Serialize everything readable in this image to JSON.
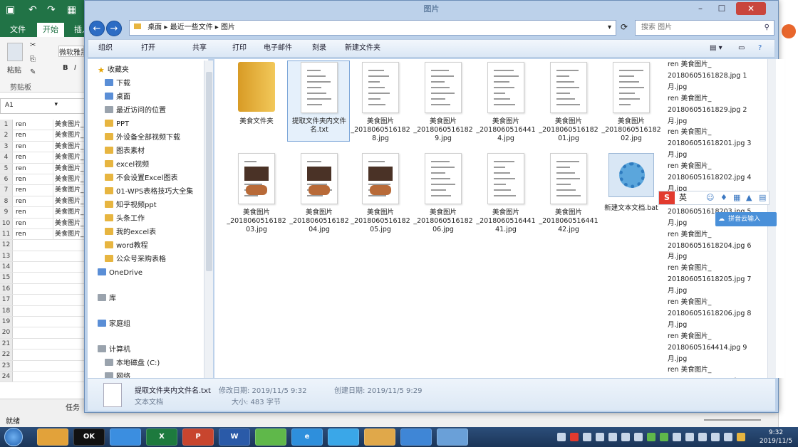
{
  "excel": {
    "tabs": [
      "文件",
      "开始",
      "插入"
    ],
    "font_box": "微软雅黑",
    "paste_label": "粘贴",
    "clipboard_label": "剪贴板",
    "name_box": "A1",
    "rows": [
      {
        "n": "1",
        "a": "ren",
        "b": "美食图片_"
      },
      {
        "n": "2",
        "a": "ren",
        "b": "美食图片_"
      },
      {
        "n": "3",
        "a": "ren",
        "b": "美食图片_"
      },
      {
        "n": "4",
        "a": "ren",
        "b": "美食图片_"
      },
      {
        "n": "5",
        "a": "ren",
        "b": "美食图片_"
      },
      {
        "n": "6",
        "a": "ren",
        "b": "美食图片_"
      },
      {
        "n": "7",
        "a": "ren",
        "b": "美食图片_"
      },
      {
        "n": "8",
        "a": "ren",
        "b": "美食图片_"
      },
      {
        "n": "9",
        "a": "ren",
        "b": "美食图片_"
      },
      {
        "n": "10",
        "a": "ren",
        "b": "美食图片_"
      },
      {
        "n": "11",
        "a": "ren",
        "b": "美食图片_"
      },
      {
        "n": "12",
        "a": "",
        "b": ""
      },
      {
        "n": "13",
        "a": "",
        "b": ""
      },
      {
        "n": "14",
        "a": "",
        "b": ""
      },
      {
        "n": "15",
        "a": "",
        "b": ""
      },
      {
        "n": "16",
        "a": "",
        "b": ""
      },
      {
        "n": "17",
        "a": "",
        "b": ""
      },
      {
        "n": "18",
        "a": "",
        "b": ""
      },
      {
        "n": "19",
        "a": "",
        "b": ""
      },
      {
        "n": "20",
        "a": "",
        "b": ""
      },
      {
        "n": "21",
        "a": "",
        "b": ""
      },
      {
        "n": "22",
        "a": "",
        "b": ""
      },
      {
        "n": "23",
        "a": "",
        "b": ""
      },
      {
        "n": "24",
        "a": "",
        "b": ""
      }
    ],
    "status": "就绪",
    "sheet_tab": "任务"
  },
  "explorer": {
    "title": "图片",
    "address": [
      "桌面",
      "最近一些文件",
      "图片"
    ],
    "search_placeholder": "搜索 图片",
    "toolbar": [
      "组织",
      "打开",
      "共享",
      "打印",
      "电子邮件",
      "刻录",
      "新建文件夹"
    ],
    "nav": [
      {
        "label": "收藏夹",
        "icon": "star"
      },
      {
        "label": "下载",
        "icon": "blue"
      },
      {
        "label": "桌面",
        "icon": "blue"
      },
      {
        "label": "最近访问的位置",
        "icon": "gray"
      },
      {
        "label": "PPT",
        "icon": "folder"
      },
      {
        "label": "外设备全部视频下载",
        "icon": "folder"
      },
      {
        "label": "图表素材",
        "icon": "folder"
      },
      {
        "label": "excel视频",
        "icon": "folder"
      },
      {
        "label": "不会设置Excel图表",
        "icon": "folder"
      },
      {
        "label": "01-WPS表格技巧大全集",
        "icon": "folder"
      },
      {
        "label": "知乎视频ppt",
        "icon": "folder"
      },
      {
        "label": "头条工作",
        "icon": "folder"
      },
      {
        "label": "我的excel表",
        "icon": "folder"
      },
      {
        "label": "word教程",
        "icon": "folder"
      },
      {
        "label": "公众号采购表格",
        "icon": "folder"
      },
      {
        "label": "OneDrive",
        "icon": "blue"
      },
      {
        "label": "库",
        "icon": "gray"
      },
      {
        "label": "家庭组",
        "icon": "blue"
      },
      {
        "label": "计算机",
        "icon": "gray"
      },
      {
        "label": "本地磁盘 (C:)",
        "icon": "gray"
      },
      {
        "label": "网络",
        "icon": "gray"
      }
    ],
    "files": [
      {
        "name": "美食文件夹",
        "kind": "folder"
      },
      {
        "name": "提取文件夹内文件名.txt",
        "kind": "doc"
      },
      {
        "name": "美食图片_2018060516182 8.jpg",
        "kind": "doc"
      },
      {
        "name": "美食图片_2018060516182 9.jpg",
        "kind": "doc"
      },
      {
        "name": "美食图片_2018060516441 4.jpg",
        "kind": "doc"
      },
      {
        "name": "美食图片_2018060516182 01.jpg",
        "kind": "doc"
      },
      {
        "name": "美食图片_2018060516182 02.jpg",
        "kind": "doc"
      },
      {
        "name": "美食图片_2018060516182 03.jpg",
        "kind": "photo"
      },
      {
        "name": "美食图片_2018060516182 04.jpg",
        "kind": "photo"
      },
      {
        "name": "美食图片_2018060516182 05.jpg",
        "kind": "photo"
      },
      {
        "name": "美食图片_2018060516182 06.jpg",
        "kind": "doc"
      },
      {
        "name": "美食图片_2018060516441 41.jpg",
        "kind": "doc"
      },
      {
        "name": "美食图片_2018060516441 42.jpg",
        "kind": "doc"
      },
      {
        "name": "新建文本文档.bat",
        "kind": "gear"
      }
    ],
    "right_list": [
      "ren 美食图片_",
      "20180605161828.jpg 1",
      "月.jpg",
      "ren 美食图片_",
      "20180605161829.jpg 2",
      "月.jpg",
      "ren 美食图片_",
      "201806051618201.jpg 3",
      "月.jpg",
      "ren 美食图片_",
      "201806051618202.jpg 4",
      "月.jpg",
      "ren 美食图片_",
      "201806051618203.jpg 5",
      "月.jpg",
      "ren 美食图片_",
      "201806051618204.jpg 6",
      "月.jpg",
      "ren 美食图片_",
      "201806051618205.jpg 7",
      "月.jpg",
      "ren 美食图片_",
      "201806051618206.jpg 8",
      "月.jpg",
      "ren 美食图片_",
      "20180605164414.jpg 9",
      "月.jpg",
      "ren 美食图片_",
      "201806051644141.jpg 10",
      "月.jpg",
      "ren 美食图片_",
      "201806051644142.jpg 11"
    ],
    "details": {
      "filename": "提取文件夹内文件名.txt",
      "modified": "修改日期: 2019/11/5 9:32",
      "created_label": "创建日期: 2019/11/5 9:29",
      "type": "文本文档",
      "size": "大小: 483 字节"
    }
  },
  "ime": {
    "logo": "S",
    "mode": "英",
    "cloud": "拼音云输入"
  },
  "taskbar": {
    "apps": [
      "",
      "OK",
      "",
      "X",
      "P",
      "W",
      "",
      "e",
      "",
      "",
      "",
      ""
    ],
    "time": "9:32",
    "date": "2019/11/5"
  }
}
